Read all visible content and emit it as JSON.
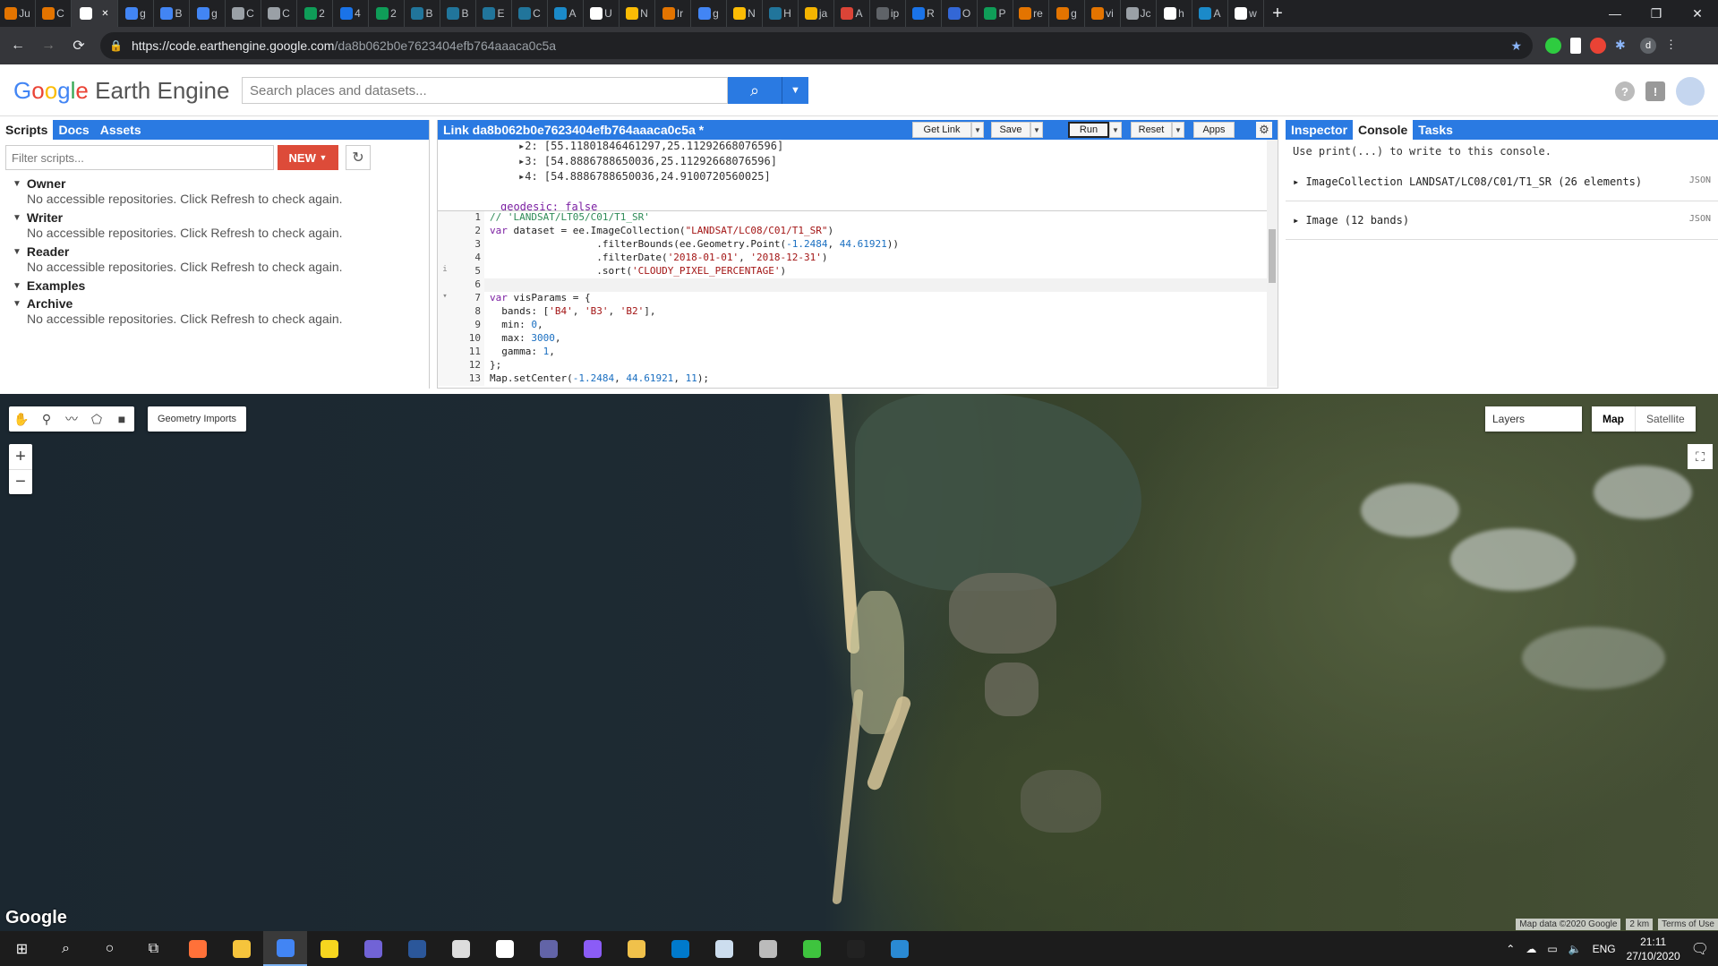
{
  "browser": {
    "tabs": [
      {
        "label": "Ju",
        "color": "#e37400"
      },
      {
        "label": "C",
        "color": "#e37400"
      },
      {
        "label": "",
        "color": "#ffffff",
        "active": true
      },
      {
        "label": "g",
        "color": "#4285f4"
      },
      {
        "label": "B",
        "color": "#4285f4"
      },
      {
        "label": "g",
        "color": "#4285f4"
      },
      {
        "label": "C",
        "color": "#9aa0a6"
      },
      {
        "label": "C",
        "color": "#9aa0a6"
      },
      {
        "label": "2",
        "color": "#0f9d58"
      },
      {
        "label": "4",
        "color": "#1a73e8"
      },
      {
        "label": "2",
        "color": "#0f9d58"
      },
      {
        "label": "B",
        "color": "#21759b"
      },
      {
        "label": "B",
        "color": "#21759b"
      },
      {
        "label": "E",
        "color": "#21759b"
      },
      {
        "label": "C",
        "color": "#21759b"
      },
      {
        "label": "A",
        "color": "#1b8ac9"
      },
      {
        "label": "U",
        "color": "#ffffff"
      },
      {
        "label": "N",
        "color": "#fbbc05"
      },
      {
        "label": "Ir",
        "color": "#e37400"
      },
      {
        "label": "g",
        "color": "#4285f4"
      },
      {
        "label": "N",
        "color": "#fbbc05"
      },
      {
        "label": "H",
        "color": "#21759b"
      },
      {
        "label": "ja",
        "color": "#f4b400"
      },
      {
        "label": "A",
        "color": "#db4437"
      },
      {
        "label": "ip",
        "color": "#5f6368"
      },
      {
        "label": "R",
        "color": "#1a73e8"
      },
      {
        "label": "O",
        "color": "#3367d6"
      },
      {
        "label": "P",
        "color": "#0f9d58"
      },
      {
        "label": "re",
        "color": "#e37400"
      },
      {
        "label": "g",
        "color": "#e37400"
      },
      {
        "label": "vi",
        "color": "#e37400"
      },
      {
        "label": "Jc",
        "color": "#9aa0a6"
      },
      {
        "label": "h",
        "color": "#ffffff"
      },
      {
        "label": "A",
        "color": "#1b8ac9"
      },
      {
        "label": "w",
        "color": "#ffffff"
      }
    ],
    "close_tab": "✕",
    "new_tab": "+",
    "url_host": "https://code.earthengine.google.com",
    "url_path": "/da8b062b0e7623404efb764aaaca0c5a",
    "profile_initial": "d"
  },
  "header": {
    "logo_google": [
      "G",
      "o",
      "o",
      "g",
      "l",
      "e"
    ],
    "logo_product": "Earth Engine",
    "search_placeholder": "Search places and datasets...",
    "help": "?",
    "feedback": "!"
  },
  "left_panel": {
    "tabs": [
      "Scripts",
      "Docs",
      "Assets"
    ],
    "filter_placeholder": "Filter scripts...",
    "new_button": "NEW",
    "tree": [
      {
        "name": "Owner",
        "msg": "No accessible repositories. Click Refresh to check again."
      },
      {
        "name": "Writer",
        "msg": "No accessible repositories. Click Refresh to check again."
      },
      {
        "name": "Reader",
        "msg": "No accessible repositories. Click Refresh to check again."
      },
      {
        "name": "Examples",
        "msg": ""
      },
      {
        "name": "Archive",
        "msg": "No accessible repositories. Click Refresh to check again."
      }
    ]
  },
  "editor": {
    "title": "Link da8b062b0e7623404efb764aaaca0c5a *",
    "buttons": {
      "get_link": "Get Link",
      "save": "Save",
      "run": "Run",
      "reset": "Reset",
      "apps": "Apps"
    },
    "tooltip_lines": [
      "▸2: [55.11801846461297,25.11292668076596]",
      "▸3: [54.8886788650036,25.11292668076596]",
      "▸4: [54.8886788650036,24.9100720560025]",
      "",
      "geodesic: false"
    ],
    "code_lines": [
      {
        "n": "1",
        "html": "<span class='cm'>// 'LANDSAT/LT05/C01/T1_SR'</span>"
      },
      {
        "n": "2",
        "html": "<span class='kw'>var</span> dataset = ee.ImageCollection(<span class='str'>\"LANDSAT/LC08/C01/T1_SR\"</span>)"
      },
      {
        "n": "3",
        "html": "                  .filterBounds(ee.Geometry.Point(<span class='num'>-1.2484</span>, <span class='num'>44.61921</span>))"
      },
      {
        "n": "4",
        "html": "                  .filterDate(<span class='str'>'2018-01-01'</span>, <span class='str'>'2018-12-31'</span>)"
      },
      {
        "n": "5",
        "html": "                  .sort(<span class='str'>'CLOUDY_PIXEL_PERCENTAGE'</span>)",
        "gutter": "i"
      },
      {
        "n": "6",
        "html": "",
        "current": true
      },
      {
        "n": "7",
        "html": "<span class='kw'>var</span> visParams = {",
        "fold": true
      },
      {
        "n": "8",
        "html": "  bands: [<span class='str'>'B4'</span>, <span class='str'>'B3'</span>, <span class='str'>'B2'</span>],"
      },
      {
        "n": "9",
        "html": "  min: <span class='num'>0</span>,"
      },
      {
        "n": "10",
        "html": "  max: <span class='num'>3000</span>,"
      },
      {
        "n": "11",
        "html": "  gamma: <span class='num'>1</span>,"
      },
      {
        "n": "12",
        "html": "};"
      },
      {
        "n": "13",
        "html": "Map.setCenter(<span class='num'>-1.2484</span>, <span class='num'>44.61921</span>, <span class='num'>11</span>);"
      }
    ]
  },
  "right_panel": {
    "tabs": [
      "Inspector",
      "Console",
      "Tasks"
    ],
    "console_msg": "Use print(...) to write to this console.",
    "entries": [
      {
        "label": "ImageCollection LANDSAT/LC08/C01/T1_SR (26 elements)",
        "tag": "JSON"
      },
      {
        "label": "Image (12 bands)",
        "tag": "JSON"
      }
    ]
  },
  "map": {
    "geometry_imports": "Geometry Imports",
    "layers": "Layers",
    "map_btn": "Map",
    "satellite_btn": "Satellite",
    "zoom_in": "+",
    "zoom_out": "−",
    "watermark": "Google",
    "attribution": "Map data ©2020 Google",
    "scale": "2 km",
    "terms": "Terms of Use"
  },
  "taskbar": {
    "apps": [
      {
        "name": "firefox",
        "color": "#ff7139"
      },
      {
        "name": "file-explorer",
        "color": "#f5c43c"
      },
      {
        "name": "chrome",
        "color": "#4285f4",
        "active": true
      },
      {
        "name": "sticky-notes",
        "color": "#f7d61f"
      },
      {
        "name": "outlook",
        "color": "#7163d6"
      },
      {
        "name": "word",
        "color": "#2b579a"
      },
      {
        "name": "excel-like",
        "color": "#ddd"
      },
      {
        "name": "unity",
        "color": "#fff"
      },
      {
        "name": "teams",
        "color": "#6264a7"
      },
      {
        "name": "app-purple",
        "color": "#8b5cf6"
      },
      {
        "name": "git",
        "color": "#f0c14b"
      },
      {
        "name": "vscode",
        "color": "#007acc"
      },
      {
        "name": "3d-viewer",
        "color": "#cde"
      },
      {
        "name": "db-app",
        "color": "#bbb"
      },
      {
        "name": "app-green",
        "color": "#3ec43e"
      },
      {
        "name": "terminal",
        "color": "#222"
      },
      {
        "name": "photos",
        "color": "#2a8ad4"
      }
    ],
    "lang": "ENG",
    "time": "21:11",
    "date": "27/10/2020"
  }
}
